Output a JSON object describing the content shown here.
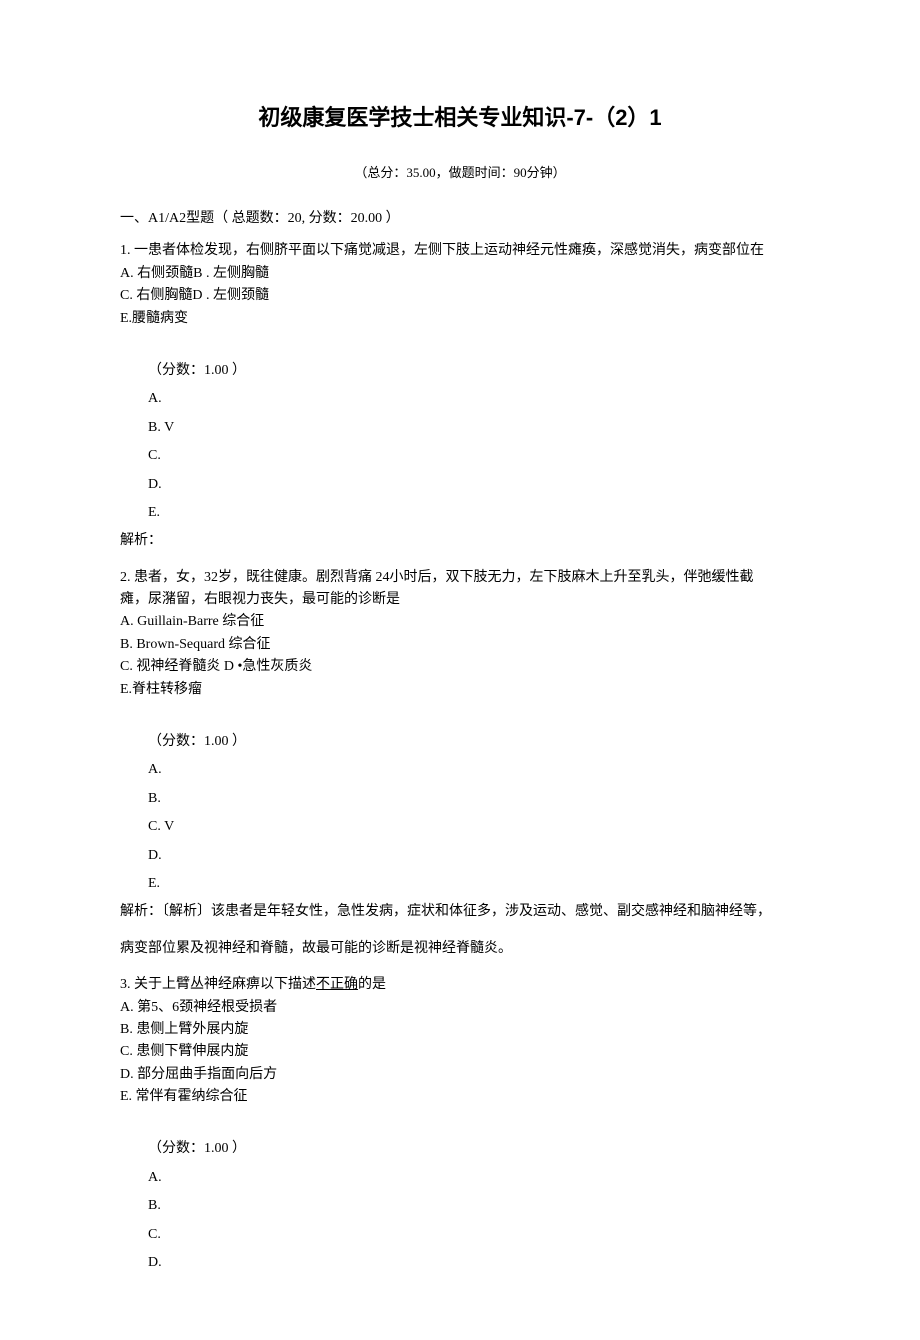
{
  "title": "初级康复医学技士相关专业知识-7-（2）1",
  "summary": "（总分：35.00，做题时间：90分钟）",
  "section": {
    "heading_prefix": "一、A1/A2型题（ 总题数：20, 分数：20.00 ）",
    "questions": [
      {
        "stem1": "1.  一患者体检发现，右侧脐平面以下痛觉减退，左侧下肢上运动神经元性瘫痪，深感觉消失，病变部位在",
        "optA": "A.      右侧颈髓B . 左侧胸髓",
        "optC": "C.      右侧胸髓D . 左侧颈髓",
        "optE": "E.腰髓病变",
        "scoreLine": "（分数：1.00 ）",
        "answers": {
          "A": "A.",
          "B": "B.    V",
          "C": "C.",
          "D": "D.",
          "E": "E."
        },
        "analysis": "解析："
      },
      {
        "stem1": "2.  患者，女，32岁，既往健康。剧烈背痛 24小时后，双下肢无力，左下肢麻木上升至乳头，伴弛缓性截",
        "stem2": "瘫，尿潴留，右眼视力丧失，最可能的诊断是",
        "optA": "A.  Guillain-Barre 综合征",
        "optB": "B.  Brown-Sequard 综合征",
        "optC": "C.  视神经脊髓炎  D •急性灰质炎",
        "optE": "E.脊柱转移瘤",
        "scoreLine": "（分数：1.00 ）",
        "answers": {
          "A": "A.",
          "B": "B.",
          "C": "C.    V",
          "D": "D.",
          "E": "E."
        },
        "analysis1": "解析：〔解析〕该患者是年轻女性，急性发病，症状和体征多，涉及运动、感觉、副交感神经和脑神经等，",
        "analysis2": "病变部位累及视神经和脊髓，故最可能的诊断是视神经脊髓炎。"
      },
      {
        "stem_pre": "3.  关于上臂丛神经麻痹以下描述",
        "stem_u": "不正确",
        "stem_post": "的是",
        "optA": "A.  第5、6颈神经根受损者",
        "optB": "B.  患侧上臂外展内旋",
        "optC": "C.  患侧下臂伸展内旋",
        "optD": "D.  部分屈曲手指面向后方",
        "optE": "E.  常伴有霍纳综合征",
        "scoreLine": "（分数：1.00 ）",
        "answers": {
          "A": "A.",
          "B": "B.",
          "C": "C.",
          "D": "D."
        }
      }
    ]
  }
}
